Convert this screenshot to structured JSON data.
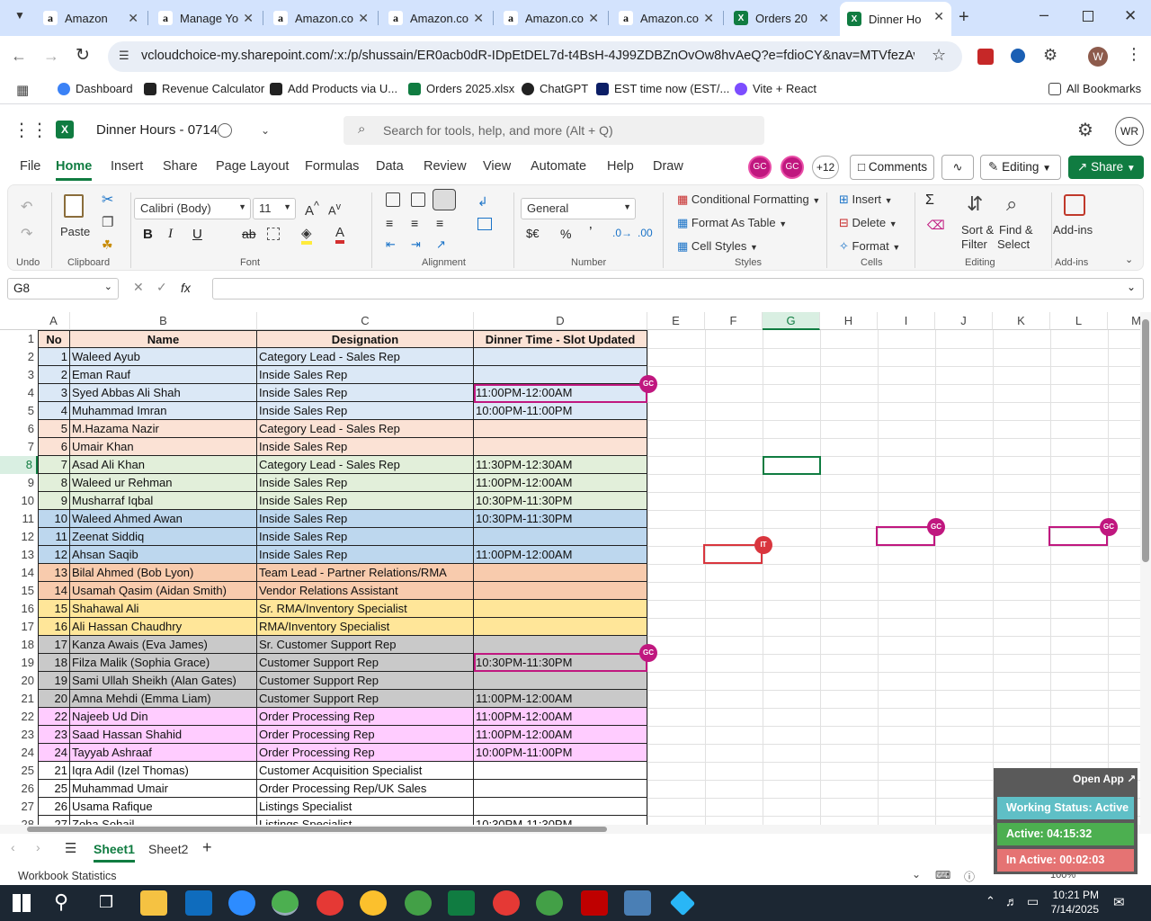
{
  "browser": {
    "tabs": [
      {
        "label": "Amazon",
        "icon": "amazon-icon"
      },
      {
        "label": "Manage Yo",
        "icon": "amazon-icon"
      },
      {
        "label": "Amazon.co",
        "icon": "amazon-icon"
      },
      {
        "label": "Amazon.co",
        "icon": "amazon-icon"
      },
      {
        "label": "Amazon.co",
        "icon": "amazon-icon"
      },
      {
        "label": "Amazon.co",
        "icon": "amazon-icon"
      },
      {
        "label": "Orders 20",
        "icon": "excel-icon"
      },
      {
        "label": "Dinner Ho",
        "icon": "excel-icon"
      }
    ],
    "url": "vcloudchoice-my.sharepoint.com/:x:/p/shussain/ER0acb0dR-IDpEtDEL7d-t4BsH-4J99ZDBZnOvOw8hvAeQ?e=fdioCY&nav=MTVfezAwMDA...",
    "profile_initial": "W",
    "bookmarks": [
      "Dashboard",
      "Revenue Calculator",
      "Add Products via U...",
      "Orders 2025.xlsx",
      "ChatGPT",
      "EST time now (EST/...",
      "Vite + React"
    ],
    "all_bookmarks": "All Bookmarks"
  },
  "excel": {
    "file_title": "Dinner Hours - 0714",
    "search_placeholder": "Search for tools, help, and more (Alt + Q)",
    "user_initials": "WR",
    "menus": [
      "File",
      "Home",
      "Insert",
      "Share",
      "Page Layout",
      "Formulas",
      "Data",
      "Review",
      "View",
      "Automate",
      "Help",
      "Draw"
    ],
    "collab_badges": [
      "GC",
      "GC"
    ],
    "collab_more": "+12",
    "comments_label": "Comments",
    "editing_label": "Editing",
    "share_label": "Share",
    "ribbon": {
      "undo": "Undo",
      "paste": "Paste",
      "clipboard": "Clipboard",
      "font_name": "Calibri (Body)",
      "font_size": "11",
      "font": "Font",
      "alignment": "Alignment",
      "number_format": "General",
      "number": "Number",
      "conditional_formatting": "Conditional Formatting",
      "format_as_table": "Format As Table",
      "cell_styles": "Cell Styles",
      "styles": "Styles",
      "insert": "Insert",
      "delete": "Delete",
      "format": "Format",
      "cells": "Cells",
      "sort_filter_1": "Sort &",
      "sort_filter_2": "Filter",
      "find_select_1": "Find &",
      "find_select_2": "Select",
      "editing": "Editing",
      "addins": "Add-ins",
      "addins_group": "Add-ins"
    },
    "name_box": "G8",
    "fx": "fx",
    "columns": [
      "A",
      "B",
      "C",
      "D",
      "E",
      "F",
      "G",
      "H",
      "I",
      "J",
      "K",
      "L",
      "M"
    ],
    "header": {
      "no": "No",
      "name": "Name",
      "designation": "Designation",
      "dinner": "Dinner Time - Slot Updated"
    },
    "rows": [
      {
        "r": "2",
        "no": "1",
        "name": "Waleed Ayub",
        "des": "Category Lead - Sales Rep",
        "time": "",
        "bg": "#dbe8f6"
      },
      {
        "r": "3",
        "no": "2",
        "name": "Eman Rauf",
        "des": "Inside Sales Rep",
        "time": "",
        "bg": "#dbe8f6"
      },
      {
        "r": "4",
        "no": "3",
        "name": "Syed Abbas Ali Shah",
        "des": "Inside Sales Rep",
        "time": "11:00PM-12:00AM",
        "bg": "#dbe8f6"
      },
      {
        "r": "5",
        "no": "4",
        "name": "Muhammad Imran",
        "des": "Inside Sales Rep",
        "time": "10:00PM-11:00PM",
        "bg": "#dbe8f6"
      },
      {
        "r": "6",
        "no": "5",
        "name": "M.Hazama Nazir",
        "des": "Category Lead - Sales Rep",
        "time": "",
        "bg": "#fbe2d5"
      },
      {
        "r": "7",
        "no": "6",
        "name": "Umair Khan",
        "des": "Inside Sales Rep",
        "time": "",
        "bg": "#fbe2d5"
      },
      {
        "r": "8",
        "no": "7",
        "name": "Asad Ali Khan",
        "des": "Category Lead - Sales Rep",
        "time": "11:30PM-12:30AM",
        "bg": "#e2efda"
      },
      {
        "r": "9",
        "no": "8",
        "name": "Waleed ur Rehman",
        "des": "Inside Sales Rep",
        "time": "11:00PM-12:00AM",
        "bg": "#e2efda"
      },
      {
        "r": "10",
        "no": "9",
        "name": "Musharraf Iqbal",
        "des": "Inside Sales Rep",
        "time": "10:30PM-11:30PM",
        "bg": "#e2efda"
      },
      {
        "r": "11",
        "no": "10",
        "name": "Waleed Ahmed Awan",
        "des": "Inside Sales Rep",
        "time": "10:30PM-11:30PM",
        "bg": "#bdd7ee"
      },
      {
        "r": "12",
        "no": "11",
        "name": "Zeenat Siddiq",
        "des": "Inside Sales Rep",
        "time": "",
        "bg": "#bdd7ee"
      },
      {
        "r": "13",
        "no": "12",
        "name": "Ahsan Saqib",
        "des": "Inside Sales Rep",
        "time": "11:00PM-12:00AM",
        "bg": "#bdd7ee"
      },
      {
        "r": "14",
        "no": "13",
        "name": "Bilal Ahmed (Bob Lyon)",
        "des": "Team Lead - Partner Relations/RMA",
        "time": "",
        "bg": "#f8cbad"
      },
      {
        "r": "15",
        "no": "14",
        "name": "Usamah Qasim (Aidan Smith)",
        "des": "Vendor Relations Assistant",
        "time": "",
        "bg": "#f8cbad"
      },
      {
        "r": "16",
        "no": "15",
        "name": "Shahawal Ali",
        "des": "Sr. RMA/Inventory Specialist",
        "time": "",
        "bg": "#ffe699"
      },
      {
        "r": "17",
        "no": "16",
        "name": "Ali Hassan Chaudhry",
        "des": "RMA/Inventory Specialist",
        "time": "",
        "bg": "#ffe699"
      },
      {
        "r": "18",
        "no": "17",
        "name": "Kanza Awais (Eva James)",
        "des": "Sr. Customer Support Rep",
        "time": "",
        "bg": "#c9c9c9"
      },
      {
        "r": "19",
        "no": "18",
        "name": "Filza Malik (Sophia Grace)",
        "des": "Customer Support Rep",
        "time": "10:30PM-11:30PM",
        "bg": "#c9c9c9"
      },
      {
        "r": "20",
        "no": "19",
        "name": "Sami Ullah Sheikh (Alan Gates)",
        "des": "Customer Support Rep",
        "time": "",
        "bg": "#c9c9c9"
      },
      {
        "r": "21",
        "no": "20",
        "name": "Amna Mehdi (Emma Liam)",
        "des": "Customer Support Rep",
        "time": "11:00PM-12:00AM",
        "bg": "#c9c9c9"
      },
      {
        "r": "22",
        "no": "22",
        "name": "Najeeb Ud Din",
        "des": "Order Processing Rep",
        "time": "11:00PM-12:00AM",
        "bg": "#ffccff"
      },
      {
        "r": "23",
        "no": "23",
        "name": "Saad Hassan Shahid",
        "des": "Order Processing Rep",
        "time": "11:00PM-12:00AM",
        "bg": "#ffccff"
      },
      {
        "r": "24",
        "no": "24",
        "name": "Tayyab Ashraaf",
        "des": "Order Processing Rep",
        "time": "10:00PM-11:00PM",
        "bg": "#ffccff"
      },
      {
        "r": "25",
        "no": "21",
        "name": "Iqra Adil (Izel Thomas)",
        "des": "Customer Acquisition Specialist",
        "time": "",
        "bg": "#ffffff"
      },
      {
        "r": "26",
        "no": "25",
        "name": "Muhammad Umair",
        "des": "Order Processing Rep/UK Sales",
        "time": "",
        "bg": "#ffffff"
      },
      {
        "r": "27",
        "no": "26",
        "name": "Usama Rafique",
        "des": "Listings Specialist",
        "time": "",
        "bg": "#ffffff"
      },
      {
        "r": "28",
        "no": "27",
        "name": "Zoha Sohail",
        "des": "Listings Specialist",
        "time": "10:30PM-11:30PM",
        "bg": "#ffffff"
      }
    ],
    "badges": {
      "gc": "GC",
      "it": "IT"
    },
    "sheets": [
      "Sheet1",
      "Sheet2"
    ],
    "workbook_stats": "Workbook Statistics",
    "zoom": "100%"
  },
  "widget": {
    "open_app": "Open App",
    "working_status": "Working Status: Active",
    "active": "Active: 04:15:32",
    "inactive": "In Active: 00:02:03"
  },
  "taskbar": {
    "time": "10:21 PM",
    "date": "7/14/2025"
  },
  "colors": {
    "accent": "#107c41",
    "collab": "#c0177f",
    "header_fill": "#fbe2d5"
  }
}
